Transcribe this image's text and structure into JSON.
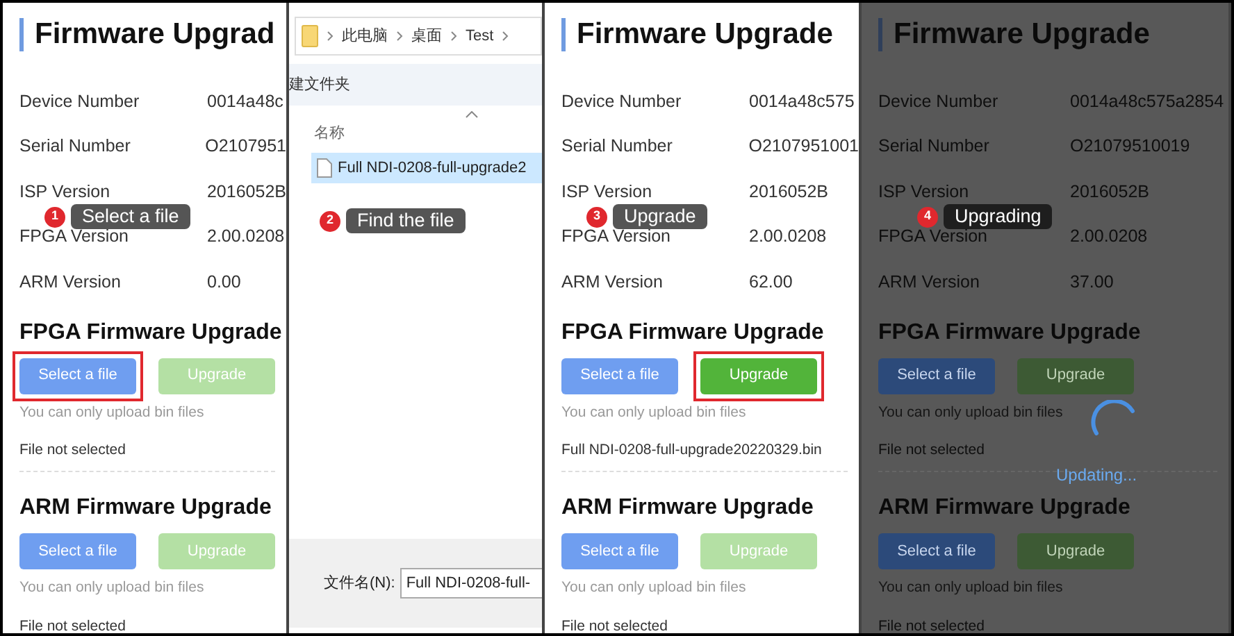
{
  "panels": [
    {
      "kind": "firmware",
      "title": "Firmware Upgrad",
      "rows": [
        {
          "label": "Device Number",
          "value": "0014a48c"
        },
        {
          "label": "Serial Number",
          "value": "O2107951"
        },
        {
          "label": "ISP Version",
          "value": "2016052B"
        },
        {
          "label": "FPGA Version",
          "value": "2.00.0208"
        },
        {
          "label": "ARM Version",
          "value": "0.00"
        }
      ],
      "sections": [
        {
          "title": "FPGA Firmware Upgrade",
          "buttons": [
            {
              "label": "Select a file",
              "kind": "select",
              "highlighted": true
            },
            {
              "label": "Upgrade",
              "kind": "upgrade",
              "enabled": false,
              "highlighted": false
            }
          ],
          "hint": "You can only upload bin files",
          "file": "File not selected"
        },
        {
          "title": "ARM Firmware Upgrade",
          "buttons": [
            {
              "label": "Select a file",
              "kind": "select",
              "highlighted": false
            },
            {
              "label": "Upgrade",
              "kind": "upgrade",
              "enabled": false,
              "highlighted": false
            }
          ],
          "hint": "You can only upload bin files",
          "file": "File not selected"
        }
      ],
      "callout": {
        "number": "1",
        "text": "Select a file"
      }
    },
    {
      "kind": "file_dialog",
      "breadcrumb": [
        "此电脑",
        "桌面",
        "Test"
      ],
      "toolbar_text": "建文件夹",
      "column_header": "名称",
      "files": [
        {
          "name": "Full NDI-0208-full-upgrade2",
          "selected": true
        }
      ],
      "filename_label": "文件名(N):",
      "filename_value": "Full NDI-0208-full-",
      "callout": {
        "number": "2",
        "text": "Find the file"
      }
    },
    {
      "kind": "firmware",
      "title": "Firmware Upgrade",
      "rows": [
        {
          "label": "Device Number",
          "value": "0014a48c575"
        },
        {
          "label": "Serial Number",
          "value": "O2107951001"
        },
        {
          "label": "ISP Version",
          "value": "2016052B"
        },
        {
          "label": "FPGA Version",
          "value": "2.00.0208"
        },
        {
          "label": "ARM Version",
          "value": "62.00"
        }
      ],
      "sections": [
        {
          "title": "FPGA Firmware Upgrade",
          "buttons": [
            {
              "label": "Select a file",
              "kind": "select",
              "highlighted": false
            },
            {
              "label": "Upgrade",
              "kind": "upgrade",
              "enabled": true,
              "highlighted": true
            }
          ],
          "hint": "You can only upload bin files",
          "file": "Full NDI-0208-full-upgrade20220329.bin"
        },
        {
          "title": "ARM Firmware Upgrade",
          "buttons": [
            {
              "label": "Select a file",
              "kind": "select",
              "highlighted": false
            },
            {
              "label": "Upgrade",
              "kind": "upgrade",
              "enabled": false,
              "highlighted": false
            }
          ],
          "hint": "You can only upload bin files",
          "file": "File not selected"
        }
      ],
      "callout": {
        "number": "3",
        "text": "Upgrade"
      }
    },
    {
      "kind": "firmware",
      "title": "Firmware Upgrade",
      "rows": [
        {
          "label": "Device Number",
          "value": "0014a48c575a2854"
        },
        {
          "label": "Serial Number",
          "value": "O21079510019"
        },
        {
          "label": "ISP Version",
          "value": "2016052B"
        },
        {
          "label": "FPGA Version",
          "value": "2.00.0208"
        },
        {
          "label": "ARM Version",
          "value": "37.00"
        }
      ],
      "sections": [
        {
          "title": "FPGA Firmware Upgrade",
          "buttons": [
            {
              "label": "Select a file",
              "kind": "select",
              "highlighted": false
            },
            {
              "label": "Upgrade",
              "kind": "upgrade",
              "enabled": false,
              "highlighted": false
            }
          ],
          "hint": "You can only upload bin files",
          "file": "File not selected"
        },
        {
          "title": "ARM Firmware Upgrade",
          "buttons": [
            {
              "label": "Select a file",
              "kind": "select",
              "highlighted": false
            },
            {
              "label": "Upgrade",
              "kind": "upgrade",
              "enabled": false,
              "highlighted": false
            }
          ],
          "hint": "You can only upload bin files",
          "file": "File not selected"
        }
      ],
      "callout": {
        "number": "4",
        "text": "Upgrading"
      },
      "loading": {
        "text": "Updating..."
      }
    }
  ]
}
